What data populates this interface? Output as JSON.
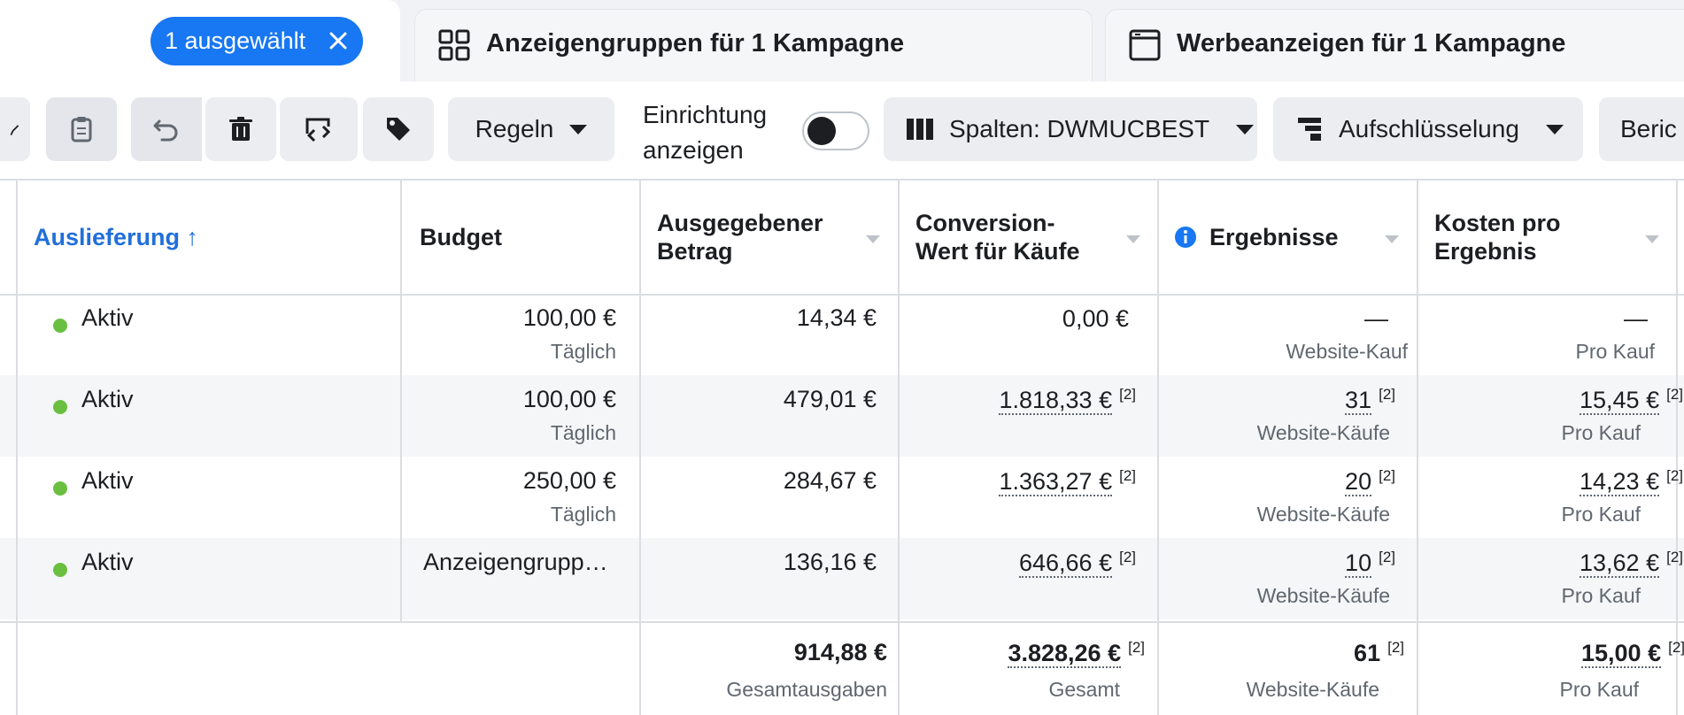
{
  "tabs": {
    "campaign": {
      "chip_label": "1 ausgewählt"
    },
    "adsets": {
      "label": "Anzeigengruppen für 1 Kampagne"
    },
    "ads": {
      "label": "Werbeanzeigen für 1 Kampagne"
    }
  },
  "toolbar": {
    "rules_label": "Regeln",
    "setup_label_line1": "Einrichtung",
    "setup_label_line2": "anzeigen",
    "columns_label": "Spalten: DWMUCBEST",
    "breakdown_label": "Aufschlüsselung",
    "reports_label": "Beric"
  },
  "table": {
    "headers": {
      "delivery": "Auslieferung ↑",
      "budget": "Budget",
      "spent_line1": "Ausgegebener",
      "spent_line2": "Betrag",
      "conv_line1": "Conversion-",
      "conv_line2": "Wert für Käufe",
      "results": "Ergebnisse",
      "cost_line1": "Kosten pro",
      "cost_line2": "Ergebnis"
    },
    "rows": [
      {
        "status": "Aktiv",
        "budget": "100,00 €",
        "budget_sub": "Täglich",
        "spent": "14,34 €",
        "conv": "0,00 €",
        "conv_sup": "",
        "results": "—",
        "results_sup": "",
        "results_sub": "Website-Kauf",
        "cost": "—",
        "cost_sup": "",
        "cost_sub": "Pro Kauf"
      },
      {
        "status": "Aktiv",
        "budget": "100,00 €",
        "budget_sub": "Täglich",
        "spent": "479,01 €",
        "conv": "1.818,33 €",
        "conv_sup": "[2]",
        "results": "31",
        "results_sup": "[2]",
        "results_sub": "Website-Käufe",
        "cost": "15,45 €",
        "cost_sup": "[2]",
        "cost_sub": "Pro Kauf"
      },
      {
        "status": "Aktiv",
        "budget": "250,00 €",
        "budget_sub": "Täglich",
        "spent": "284,67 €",
        "conv": "1.363,27 €",
        "conv_sup": "[2]",
        "results": "20",
        "results_sup": "[2]",
        "results_sub": "Website-Käufe",
        "cost": "14,23 €",
        "cost_sup": "[2]",
        "cost_sub": "Pro Kauf"
      },
      {
        "status": "Aktiv",
        "budget": "Anzeigengrupp…",
        "budget_sub": "",
        "spent": "136,16 €",
        "conv": "646,66 €",
        "conv_sup": "[2]",
        "results": "10",
        "results_sup": "[2]",
        "results_sub": "Website-Käufe",
        "cost": "13,62 €",
        "cost_sup": "[2]",
        "cost_sub": "Pro Kauf"
      }
    ],
    "totals": {
      "spent": "914,88 €",
      "spent_sub": "Gesamtausgaben",
      "conv": "3.828,26 €",
      "conv_sup": "[2]",
      "conv_sub": "Gesamt",
      "results": "61",
      "results_sup": "[2]",
      "results_sub": "Website-Käufe",
      "cost": "15,00 €",
      "cost_sup": "[2]",
      "cost_sub": "Pro Kauf"
    }
  },
  "colors": {
    "accent": "#1877f2",
    "active": "#6abf40",
    "header_link": "#216fdb"
  },
  "icons": {
    "adsets_tab": "grid-icon",
    "ads_tab": "ad-frame-icon",
    "chip_close": "close-icon",
    "clipboard": "clipboard-icon",
    "undo": "undo-icon",
    "delete": "trash-icon",
    "transfer": "transfer-icon",
    "tag": "tag-icon",
    "columns": "columns-icon",
    "breakdown": "breakdown-icon",
    "results_info": "info-icon"
  }
}
